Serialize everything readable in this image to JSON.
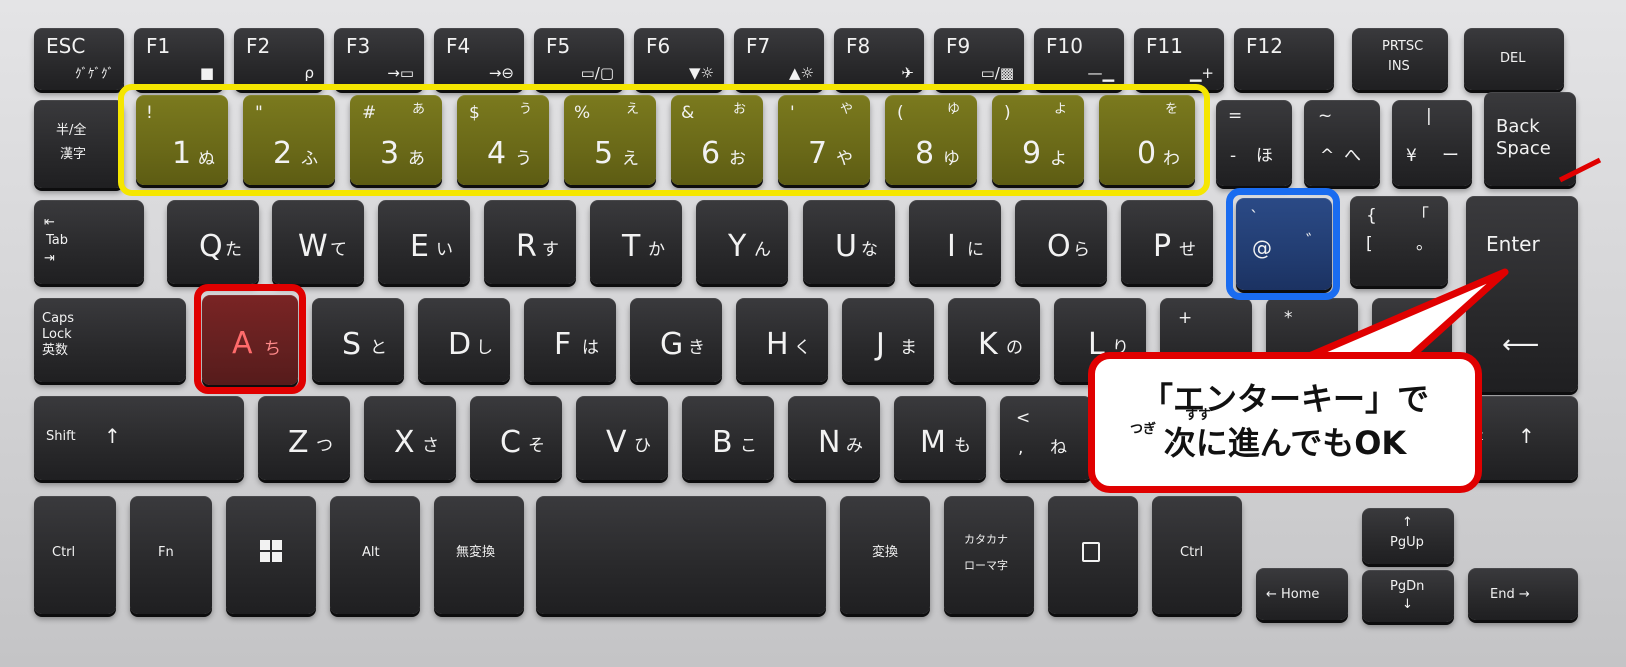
{
  "colors": {
    "highlight_yellow": "#f5e600",
    "highlight_red": "#e00000",
    "highlight_blue": "#1a6cf0"
  },
  "function_row": [
    {
      "label": "ESC",
      "icon_text": "ｸﾞｹﾞｸﾞ"
    },
    {
      "label": "F1",
      "icon_text": "🔒"
    },
    {
      "label": "F2",
      "icon_text": "ρ"
    },
    {
      "label": "F3",
      "icon_text": "→▭"
    },
    {
      "label": "F4",
      "icon_text": "→⊖"
    },
    {
      "label": "F5",
      "icon_text": "▭/▢"
    },
    {
      "label": "F6",
      "icon_text": "▼☼"
    },
    {
      "label": "F7",
      "icon_text": "▲☼"
    },
    {
      "label": "F8",
      "icon_text": "✈"
    },
    {
      "label": "F9",
      "icon_text": "▭/▩"
    },
    {
      "label": "F10",
      "icon_text": "—▁"
    },
    {
      "label": "F11",
      "icon_text": "▁+"
    },
    {
      "label": "F12",
      "icon_text": ""
    },
    {
      "label": "PRTSC",
      "icon_text": "INS"
    },
    {
      "label": "DEL",
      "icon_text": ""
    }
  ],
  "number_row": {
    "hankaku": "半/全",
    "hankaku_sub": "漢字",
    "keys": [
      {
        "main": "1",
        "shift": "!",
        "kana": "ぬ",
        "kana_shift": ""
      },
      {
        "main": "2",
        "shift": "\"",
        "kana": "ふ",
        "kana_shift": ""
      },
      {
        "main": "3",
        "shift": "#",
        "kana": "あ",
        "kana_shift": "あ"
      },
      {
        "main": "4",
        "shift": "$",
        "kana": "う",
        "kana_shift": "う"
      },
      {
        "main": "5",
        "shift": "%",
        "kana": "え",
        "kana_shift": "え"
      },
      {
        "main": "6",
        "shift": "&",
        "kana": "お",
        "kana_shift": "お"
      },
      {
        "main": "7",
        "shift": "'",
        "kana": "や",
        "kana_shift": "や"
      },
      {
        "main": "8",
        "shift": "(",
        "kana": "ゆ",
        "kana_shift": "ゆ"
      },
      {
        "main": "9",
        "shift": ")",
        "kana": "よ",
        "kana_shift": "よ"
      },
      {
        "main": "0",
        "shift": "",
        "kana": "わ",
        "kana_shift": "を"
      }
    ],
    "extra": [
      {
        "main": "-",
        "shift": "=",
        "kana": "ほ"
      },
      {
        "main": "^",
        "shift": "~",
        "kana": "へ"
      },
      {
        "main": "¥",
        "shift": "|",
        "kana": "ー"
      }
    ],
    "backspace_1": "Back",
    "backspace_2": "Space"
  },
  "q_row": {
    "tab": "Tab",
    "keys": [
      {
        "main": "Q",
        "kana": "た"
      },
      {
        "main": "W",
        "kana": "て"
      },
      {
        "main": "E",
        "kana": "い"
      },
      {
        "main": "R",
        "kana": "す"
      },
      {
        "main": "T",
        "kana": "か"
      },
      {
        "main": "Y",
        "kana": "ん"
      },
      {
        "main": "U",
        "kana": "な"
      },
      {
        "main": "I",
        "kana": "に"
      },
      {
        "main": "O",
        "kana": "ら"
      },
      {
        "main": "P",
        "kana": "せ"
      }
    ],
    "at_key": {
      "main": "@",
      "top": "`",
      "kana": "゛"
    },
    "bracket_key": {
      "top": "{",
      "main": "[",
      "kana_top": "「",
      "kana": "。"
    },
    "enter": "Enter"
  },
  "a_row": {
    "caps_1": "Caps",
    "caps_2": "Lock",
    "caps_3": "英数",
    "keys": [
      {
        "main": "A",
        "kana": "ち"
      },
      {
        "main": "S",
        "kana": "と"
      },
      {
        "main": "D",
        "kana": "し"
      },
      {
        "main": "F",
        "kana": "は"
      },
      {
        "main": "G",
        "kana": "き"
      },
      {
        "main": "H",
        "kana": "く"
      },
      {
        "main": "J",
        "kana": "ま"
      },
      {
        "main": "K",
        "kana": "の"
      },
      {
        "main": "L",
        "kana": "り"
      }
    ],
    "semicolon_top": "+",
    "colon_top": "*",
    "enter_arrow": "⟵"
  },
  "z_row": {
    "shift_l": "Shift",
    "shift_arrow": "↑",
    "keys": [
      {
        "main": "Z",
        "kana": "つ"
      },
      {
        "main": "X",
        "kana": "さ"
      },
      {
        "main": "C",
        "kana": "そ"
      },
      {
        "main": "V",
        "kana": "ひ"
      },
      {
        "main": "B",
        "kana": "こ"
      },
      {
        "main": "N",
        "kana": "み"
      },
      {
        "main": "M",
        "kana": "も"
      }
    ],
    "comma_top": "<",
    "comma_main": ",",
    "comma_kana": "ね",
    "shift_r": "ift",
    "shift_r_arrow": "↑"
  },
  "bottom_row": {
    "ctrl_l": "Ctrl",
    "fn": "Fn",
    "alt": "Alt",
    "muhenkan": "無変換",
    "henkan": "変換",
    "kana_1": "カタカナ",
    "kana_2": "ローマ字",
    "ctrl_r": "Ctrl",
    "home": "← Home",
    "pgup": "PgUp",
    "pgdn": "PgDn",
    "end": "End →"
  },
  "callout": {
    "line1": "「エンターキー」で",
    "line2": "次に進んでもOK",
    "ruby_tsugi": "つぎ",
    "ruby_susu": "すす"
  }
}
